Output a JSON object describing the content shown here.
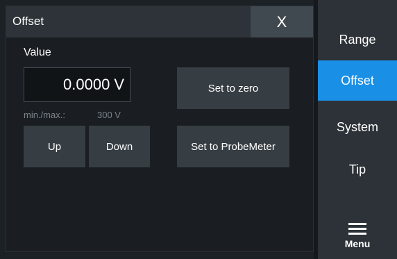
{
  "dialog": {
    "title": "Offset",
    "close_label": "X",
    "value_label": "Value",
    "value": "0.0000",
    "unit": "V",
    "minmax_label": "min./max.:",
    "minmax_value": "300 V",
    "buttons": {
      "set_zero": "Set to zero",
      "set_probemeter": "Set to ProbeMeter",
      "up": "Up",
      "down": "Down"
    }
  },
  "sidebar": {
    "items": [
      {
        "label": "Range",
        "selected": false
      },
      {
        "label": "Offset",
        "selected": true
      },
      {
        "label": "System",
        "selected": false
      },
      {
        "label": "Tip",
        "selected": false
      }
    ],
    "menu_label": "Menu",
    "menu_icon": "hamburger-icon"
  },
  "colors": {
    "accent": "#1a8fe6",
    "dialog_bg": "#1a1e22",
    "titlebar": "#2d3338",
    "button": "#363d43",
    "sidebar": "#2c3237"
  }
}
